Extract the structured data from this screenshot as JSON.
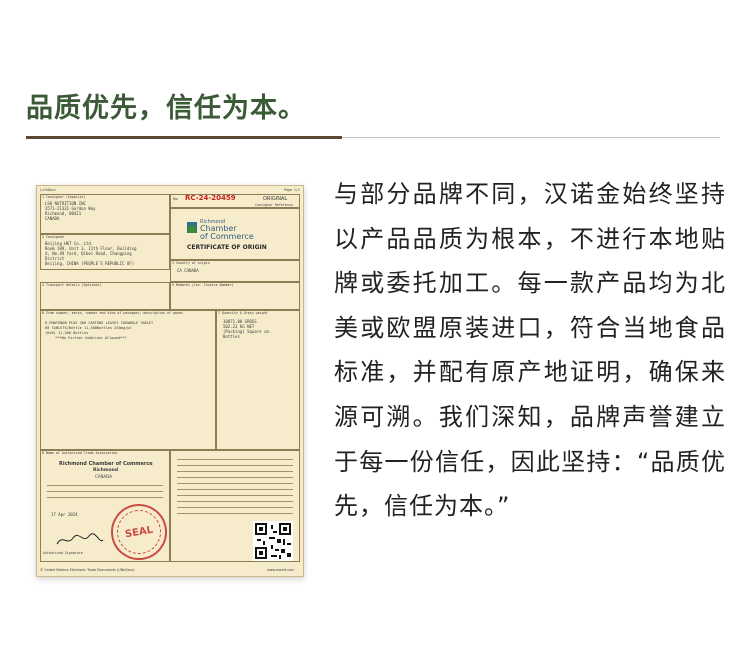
{
  "heading": "品质优先，信任为本。",
  "body_text": "与部分品牌不同，汉诺金始终坚持以产品品质为根本，不进行本地贴牌或委托加工。每一款产品均为北美或欧盟原装进口，符合当地食品标准，并配有原产地证明，确保来源可溯。我们深知，品牌声誉建立于每一份信任，因此坚持：“品质优先，信任为本。”",
  "certificate": {
    "doc_ref": "LifeDocs",
    "page": "Page 1/1",
    "label_consignor": "1 Consignor (Supplier)",
    "consignor_name": "LSK NUTRITION INC",
    "consignor_addr1": "3571-21331 Gordon Way",
    "consignor_addr2": "Richmond, 00421",
    "consignor_country": "CANADA",
    "label_consignee": "2 Consignee",
    "consignee_name": "Beijing HKT Co. Ltd.",
    "consignee_addr1": "Room 109, Unit 3, 11th Floor, Building",
    "consignee_addr2": "4, No.49 Yard, Qibei Road, Changping",
    "consignee_addr3": "District",
    "consignee_addr4": "Beijing, CHINA (PEOPLE'S REPUBLIC OF)",
    "no_label": "No",
    "cert_number": "RC-24-20459",
    "original": "ORIGINAL",
    "ref_label": "Consignor Reference",
    "chamber_line1": "Richmond",
    "chamber_line2": "Chamber",
    "chamber_line3": "of Commerce",
    "cert_title": "CERTIFICATE OF ORIGIN",
    "label_country": "3 Country of origin",
    "country_value": "CA CANADA",
    "label_transport": "4 Transport details (Optional)",
    "label_remarks": "5 Remarks (inc. Invoice Number)",
    "label_items": "6 Item number, marks, number and kind of packages; description of goods",
    "label_quantity": "7 Quantity & Gross weight",
    "item_line1": "K-POWTENON PLUS 300 CARTONS LEAVES CHEWABLE TABLET",
    "item_line2": "60 TABLETS/Bottle 11,300Bottles 250mg/pc",
    "item_line3": "(Hs8)  11,300 Bottles",
    "item_line4": "***No Further Addition Allowed***",
    "qty_line1": "10871.00 GROSS",
    "qty_line2": "502.23 KG NET",
    "qty_line3": "(Packing) Square cm.",
    "qty_line4": "Bottles",
    "label_association": "8 Name of Authorized Trade Association",
    "association_name": "Richmond Chamber of Commerce",
    "association_city": "Richmond",
    "association_country": "CANADA",
    "date": "17 Apr 2024",
    "seal_text": "SEAL",
    "signature_label": "Authorized Signature",
    "footer_left": "© United Nations Electronic Trade Documents (UNeDocs)",
    "footer_right": "www.eacert.com"
  }
}
